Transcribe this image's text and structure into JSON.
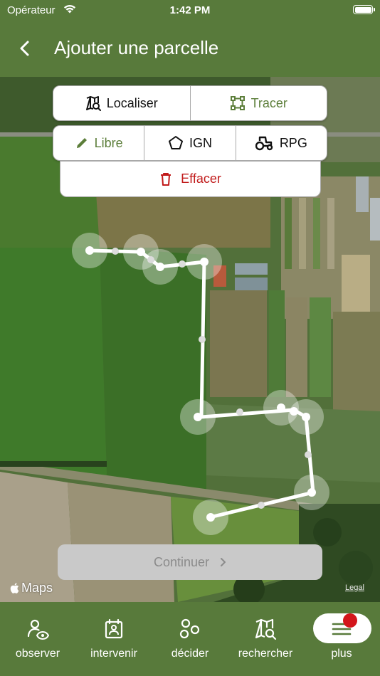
{
  "status_bar": {
    "carrier": "Opérateur",
    "time": "1:42 PM"
  },
  "header": {
    "title": "Ajouter une parcelle",
    "back_icon": "chevron-left-icon"
  },
  "mode_tabs": [
    {
      "label": "Localiser",
      "icon": "map-search-icon",
      "active": false
    },
    {
      "label": "Tracer",
      "icon": "polygon-draw-icon",
      "active": true
    }
  ],
  "draw_tabs": [
    {
      "label": "Libre",
      "icon": "pencil-icon",
      "active": true
    },
    {
      "label": "IGN",
      "icon": "pentagon-icon",
      "active": false
    },
    {
      "label": "RPG",
      "icon": "tractor-icon",
      "active": false
    }
  ],
  "erase": {
    "label": "Effacer",
    "icon": "trash-icon"
  },
  "continue": {
    "label": "Continuer",
    "enabled": false
  },
  "map": {
    "attribution": "Maps",
    "legal": "Legal"
  },
  "tab_bar": [
    {
      "label": "observer",
      "icon": "observer-icon"
    },
    {
      "label": "intervenir",
      "icon": "calendar-person-icon"
    },
    {
      "label": "décider",
      "icon": "nodes-icon"
    },
    {
      "label": "rechercher",
      "icon": "map-search-icon"
    },
    {
      "label": "plus",
      "icon": "menu-icon",
      "active": true,
      "has_badge": true
    }
  ],
  "colors": {
    "brand": "#587a3b",
    "active": "#5c7e3a",
    "danger": "#c11b1b",
    "badge": "#d3161b"
  }
}
